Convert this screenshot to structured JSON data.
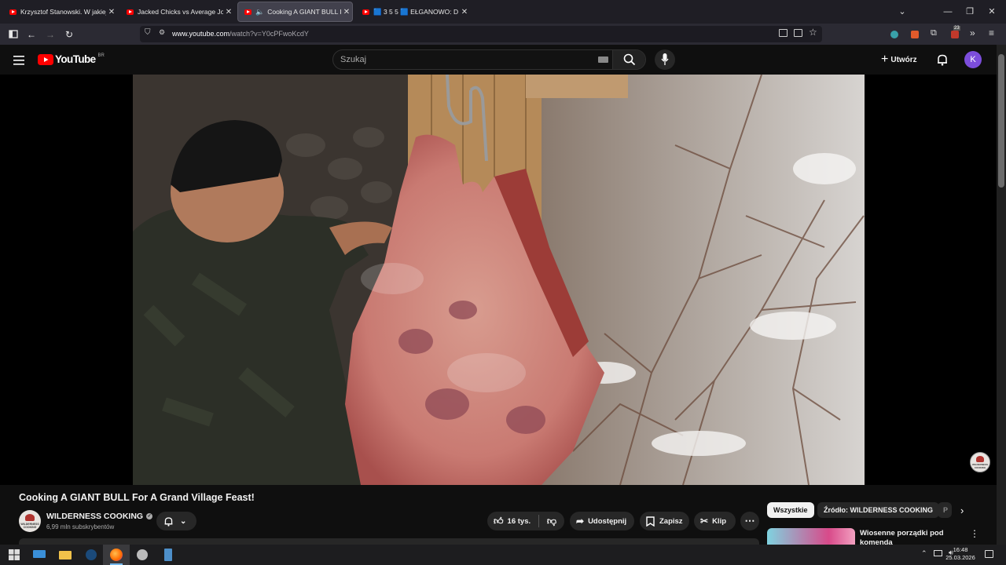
{
  "browser": {
    "tabs": [
      {
        "title": "Krzysztof Stanowski. W jakiej sp",
        "active": false
      },
      {
        "title": "Jacked Chicks vs Average Joes |",
        "active": false
      },
      {
        "title": "Cooking A GIANT BULL For",
        "active": true,
        "audio": true
      },
      {
        "title": "🟦 3 5 5 🟦 EŁGANOWO: D",
        "active": false
      }
    ],
    "url_host": "www.youtube.com",
    "url_path": "/watch?v=Y0cPFwoKcdY",
    "extension_badge": "23"
  },
  "youtube": {
    "logo_text": "YouTube",
    "logo_country": "BR",
    "search_placeholder": "Szukaj",
    "create_label": "Utwórz",
    "avatar_letter": "K",
    "accent_color": "#ff0000",
    "avatar_color": "#7c4ddb"
  },
  "video": {
    "title": "Cooking A GIANT BULL For A Grand Village Feast!",
    "channel_name": "WILDERNESS COOKING",
    "subscribers": "6,99 mln subskrybentów",
    "watermark_text": "WILDERNESS COOKING",
    "likes": "16 tys.",
    "share_label": "Udostępnij",
    "save_label": "Zapisz",
    "clip_label": "Klip"
  },
  "sidebar": {
    "chips": [
      "Wszystkie",
      "Źródło: WILDERNESS COOKING",
      "P"
    ],
    "recommended_title": "Wiosenne porządki pod komendą"
  },
  "taskbar": {
    "time": "16:48",
    "date": "25.03.2026"
  }
}
